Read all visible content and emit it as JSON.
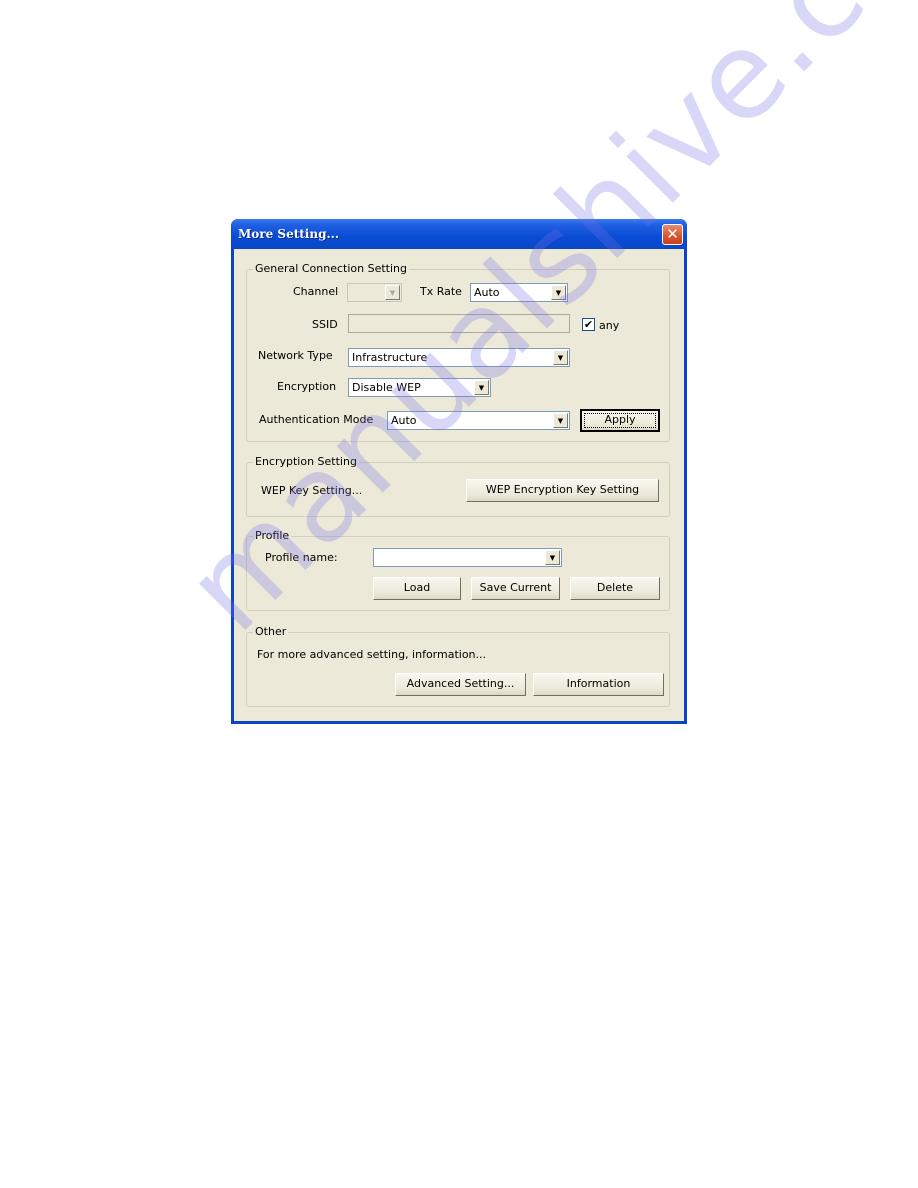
{
  "window": {
    "title": "More Setting...",
    "close_icon": "close-icon"
  },
  "general": {
    "legend": "General Connection Setting",
    "channel_label": "Channel",
    "channel_value": "",
    "tx_rate_label": "Tx Rate",
    "tx_rate_value": "Auto",
    "ssid_label": "SSID",
    "ssid_value": "",
    "any_label": "any",
    "any_checked": true,
    "any_check_glyph": "✔",
    "network_type_label": "Network Type",
    "network_type_value": "Infrastructure",
    "encryption_label": "Encryption",
    "encryption_value": "Disable WEP",
    "auth_mode_label": "Authentication Mode",
    "auth_mode_value": "Auto",
    "apply_label": "Apply"
  },
  "encryption_setting": {
    "legend": "Encryption Setting",
    "wep_key_text": "WEP Key Setting...",
    "wep_key_button": "WEP Encryption Key Setting"
  },
  "profile": {
    "legend": "Profile",
    "name_label": "Profile name:",
    "name_value": "",
    "load_label": "Load",
    "save_label": "Save Current",
    "delete_label": "Delete"
  },
  "other": {
    "legend": "Other",
    "description": "For more advanced setting, information...",
    "advanced_label": "Advanced Setting...",
    "information_label": "Information"
  },
  "icons": {
    "dropdown_arrow": "▼",
    "close": "✕"
  },
  "watermark": "manualshive.com"
}
